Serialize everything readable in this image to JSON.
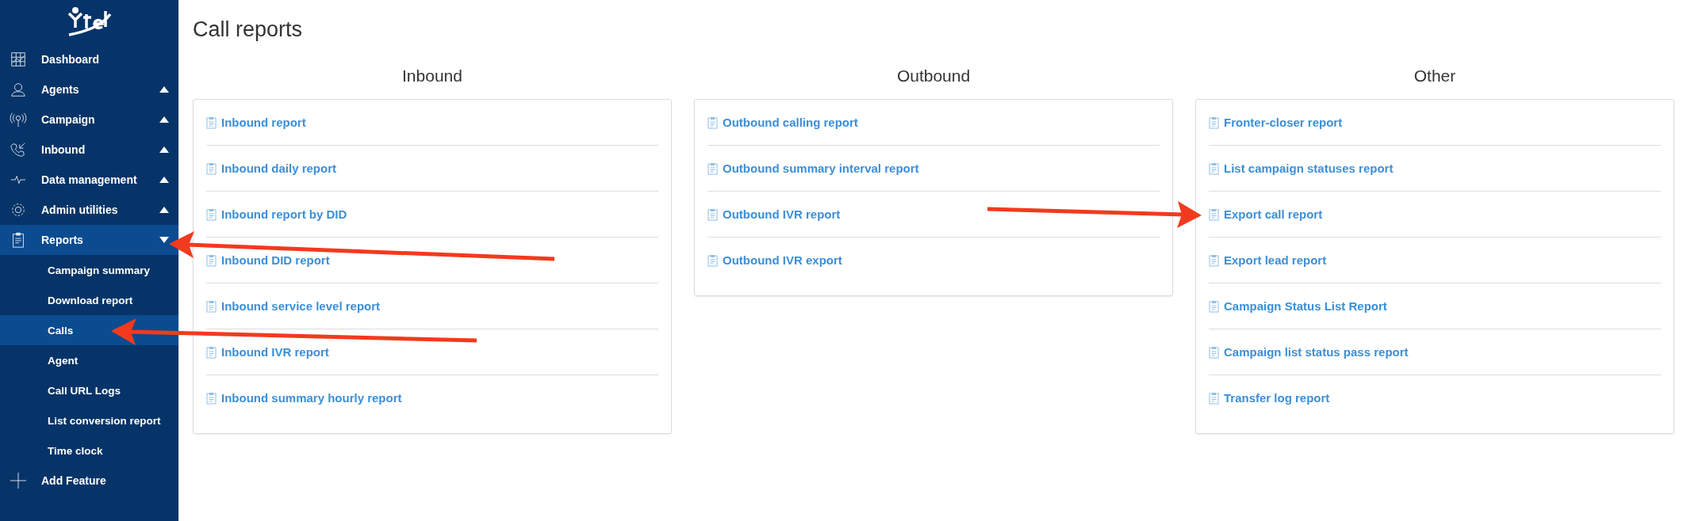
{
  "sidebar": {
    "items": [
      {
        "label": "Dashboard",
        "selected": false
      },
      {
        "label": "Agents",
        "selected": false,
        "expanded": false
      },
      {
        "label": "Campaign",
        "selected": false,
        "expanded": false
      },
      {
        "label": "Inbound",
        "selected": false,
        "expanded": false
      },
      {
        "label": "Data management",
        "selected": false,
        "expanded": false
      },
      {
        "label": "Admin utilities",
        "selected": false,
        "expanded": false
      },
      {
        "label": "Reports",
        "selected": true,
        "expanded": true,
        "children": [
          {
            "label": "Campaign summary",
            "selected": false
          },
          {
            "label": "Download report",
            "selected": false
          },
          {
            "label": "Calls",
            "selected": true
          },
          {
            "label": "Agent",
            "selected": false
          },
          {
            "label": "Call URL Logs",
            "selected": false
          },
          {
            "label": "List conversion report",
            "selected": false
          },
          {
            "label": "Time clock",
            "selected": false
          }
        ]
      }
    ],
    "add_feature": "Add Feature"
  },
  "page": {
    "title": "Call reports"
  },
  "sections": [
    {
      "title": "Inbound",
      "links": [
        "Inbound report",
        "Inbound daily report",
        "Inbound report by DID",
        "Inbound DID report",
        "Inbound service level report",
        "Inbound IVR report",
        "Inbound summary hourly report"
      ]
    },
    {
      "title": "Outbound",
      "links": [
        "Outbound calling report",
        "Outbound summary interval report",
        "Outbound IVR report",
        "Outbound IVR export"
      ]
    },
    {
      "title": "Other",
      "links": [
        "Fronter-closer report",
        "List campaign statuses report",
        "Export call report",
        "Export lead report",
        "Campaign Status List Report",
        "Campaign list status pass report",
        "Transfer log report"
      ]
    }
  ]
}
